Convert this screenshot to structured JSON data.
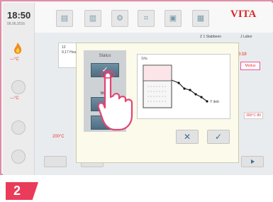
{
  "status_bar": {
    "time": "18:50",
    "date": "06.06.2016"
  },
  "sidebar": {
    "temp1": "---°C",
    "temp2": "---°C"
  },
  "brand": "VITA",
  "header": {
    "right_info_1": "Z 1 Stabbeen",
    "right_info_2": "J Labor"
  },
  "program": {
    "line1": "12",
    "line2": "9,17 Hou",
    "start_time": "3:10:10",
    "mode_button": "Modus",
    "bottom_temp": "200°C",
    "right_temp": "300°C 80"
  },
  "dialog": {
    "status_label": "Status",
    "status_option": "Wabo",
    "chart_title": "Sifa",
    "chart_end_label": "Y deb",
    "cancel_symbol": "✕",
    "confirm_symbol": "✓"
  },
  "step_number": "2"
}
